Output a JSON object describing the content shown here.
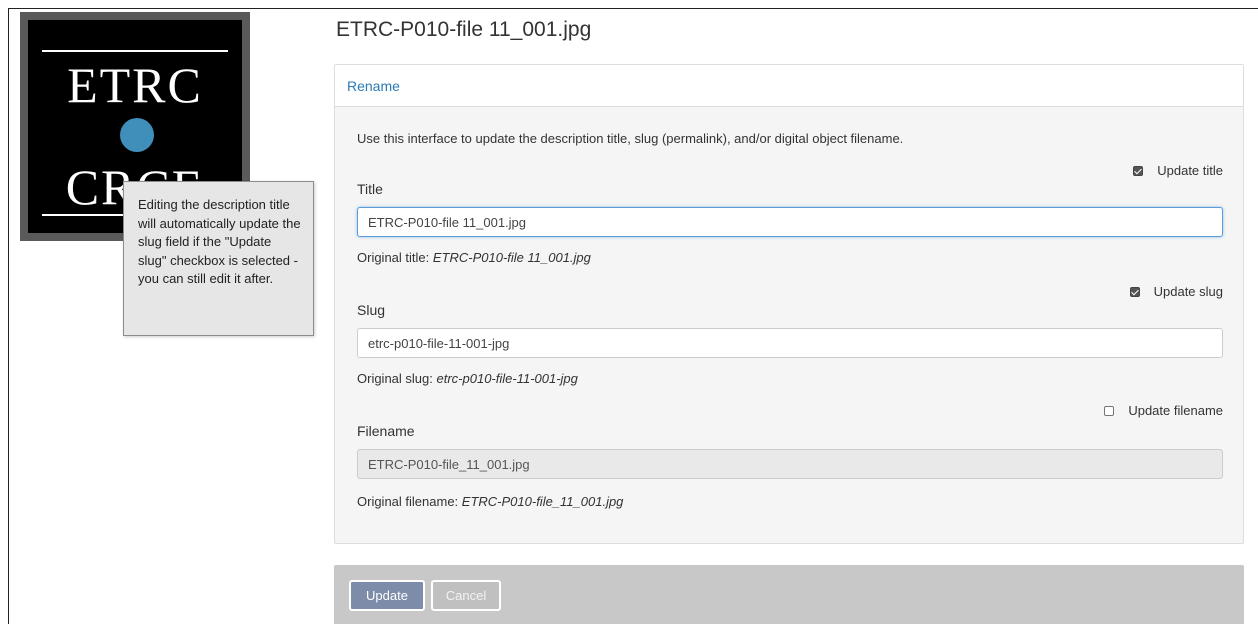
{
  "logo": {
    "line1": "ETRC",
    "line2": "CRCE",
    "accent_color": "#3f8fba"
  },
  "tooltip": {
    "text": "Editing the description title will automatically update the slug field if the \"Update slug\" checkbox is selected - you can still edit it after."
  },
  "page": {
    "title": "ETRC-P010-file 11_001.jpg"
  },
  "panel": {
    "heading": "Rename",
    "intro": "Use this interface to update the description title, slug (permalink), and/or digital object filename.",
    "fields": {
      "title": {
        "checkbox_label": "Update title",
        "checked": true,
        "label": "Title",
        "value": "ETRC-P010-file 11_001.jpg",
        "original_prefix": "Original title:",
        "original_value": "ETRC-P010-file 11_001.jpg"
      },
      "slug": {
        "checkbox_label": "Update slug",
        "checked": true,
        "label": "Slug",
        "value": "etrc-p010-file-11-001-jpg",
        "original_prefix": "Original slug:",
        "original_value": "etrc-p010-file-11-001-jpg"
      },
      "filename": {
        "checkbox_label": "Update filename",
        "checked": false,
        "label": "Filename",
        "value": "ETRC-P010-file_11_001.jpg",
        "original_prefix": "Original filename:",
        "original_value": "ETRC-P010-file_11_001.jpg"
      }
    }
  },
  "actions": {
    "update_label": "Update",
    "cancel_label": "Cancel"
  },
  "colors": {
    "link": "#2a7ab3",
    "update_button": "#7d8ca8",
    "action_bar": "#c8c8c8"
  }
}
